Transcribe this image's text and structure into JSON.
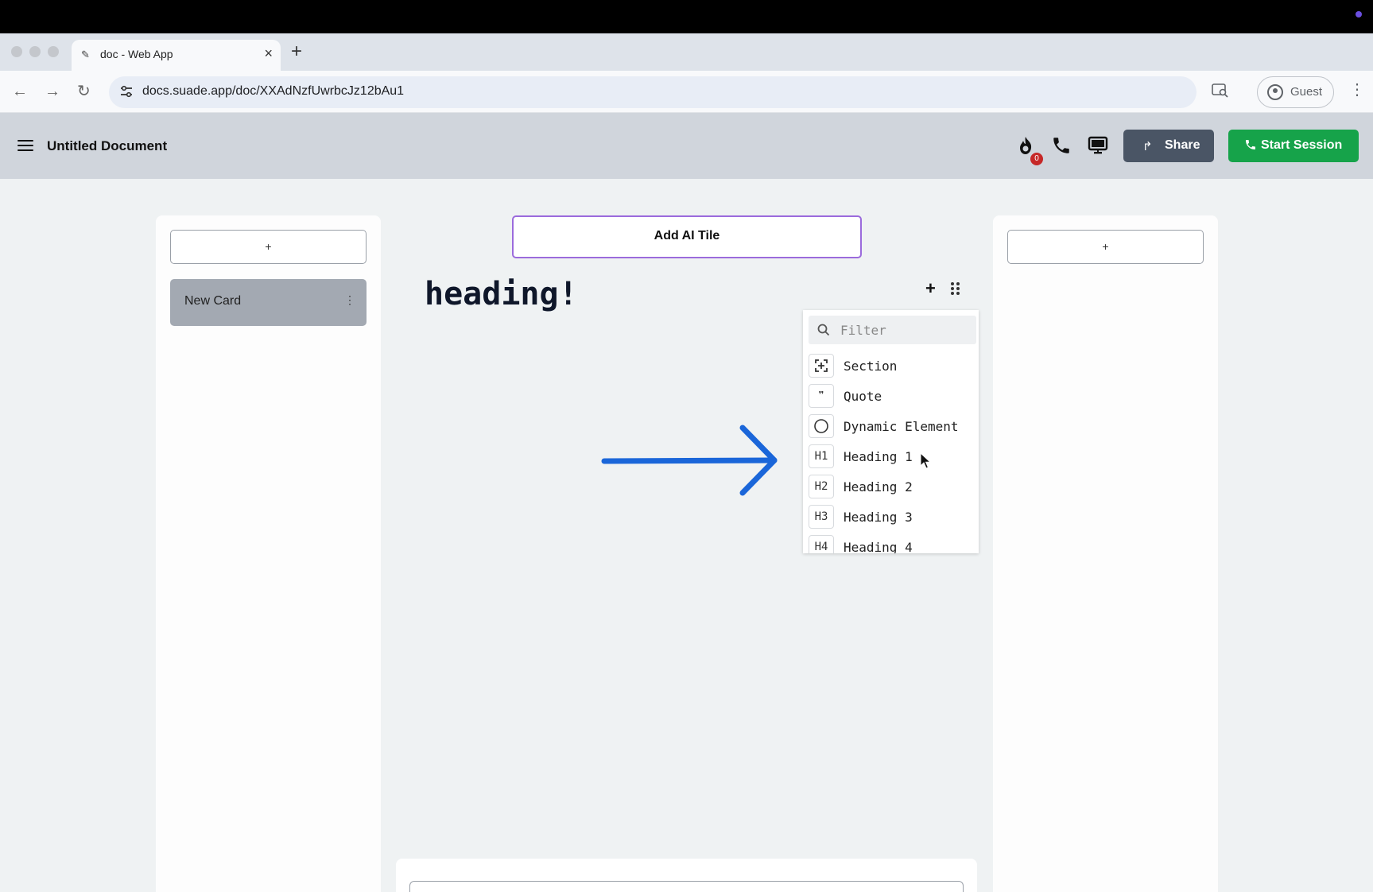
{
  "browser": {
    "tab_title": "doc - Web App",
    "new_tab": "+",
    "url": "docs.suade.app/doc/XXAdNzfUwrbcJz12bAu1",
    "profile": "Guest"
  },
  "header": {
    "title": "Untitled Document",
    "badge_count": "0",
    "share_label": "Share",
    "start_session_label": "Start Session",
    "accent_green": "#16a34a",
    "share_color": "#4a5565"
  },
  "left_panel": {
    "add_label": "+",
    "card_label": "New Card",
    "card_menu": "⋮"
  },
  "center": {
    "ai_tile_label": "Add AI Tile",
    "heading_text": "heading!",
    "block_add": "+"
  },
  "right_panel": {
    "add_label": "+"
  },
  "block_menu": {
    "filter_placeholder": "Filter",
    "items": [
      {
        "icon": "section-icon",
        "glyph": "",
        "label": "Section"
      },
      {
        "icon": "quote-icon",
        "glyph": "❞",
        "label": "Quote"
      },
      {
        "icon": "circle-icon",
        "glyph": "",
        "label": "Dynamic Element"
      },
      {
        "icon": "h1-icon",
        "glyph": "H1",
        "label": "Heading 1"
      },
      {
        "icon": "h2-icon",
        "glyph": "H2",
        "label": "Heading 2"
      },
      {
        "icon": "h3-icon",
        "glyph": "H3",
        "label": "Heading 3"
      },
      {
        "icon": "h4-icon",
        "glyph": "H4",
        "label": "Heading 4"
      }
    ]
  },
  "annotation": {
    "arrow_color": "#1a66d9"
  }
}
